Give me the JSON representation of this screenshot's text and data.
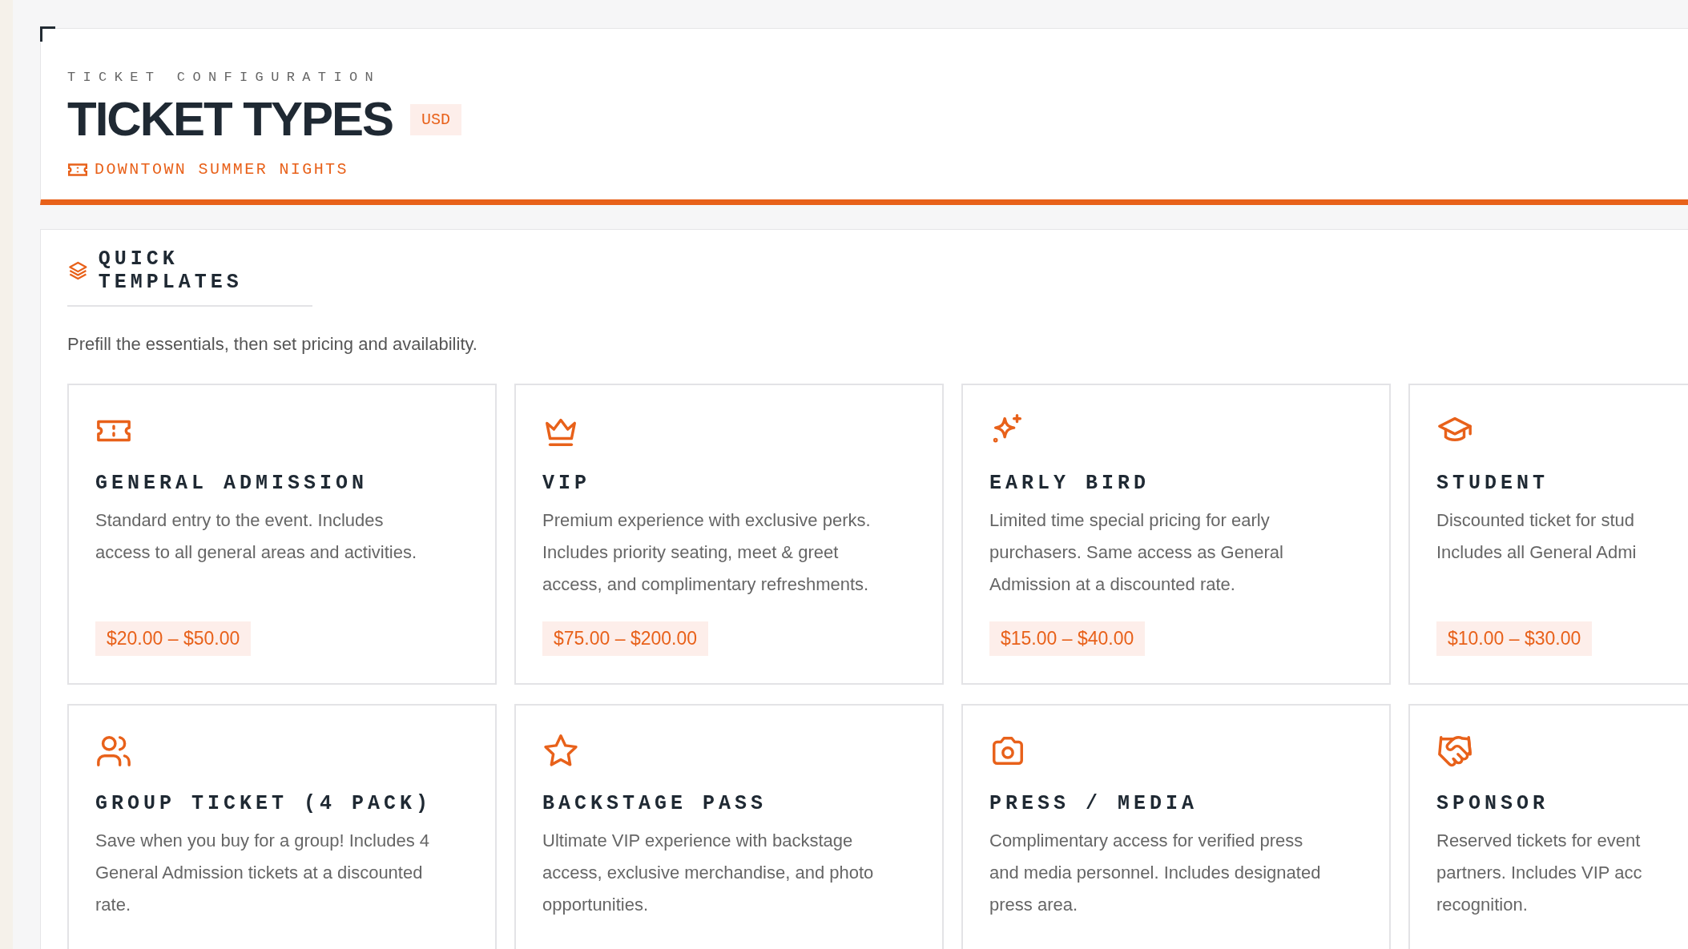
{
  "header": {
    "eyebrow": "TICKET CONFIGURATION",
    "title": "TICKET TYPES",
    "currency": "USD",
    "event": "DOWNTOWN SUMMER NIGHTS"
  },
  "templates": {
    "title": "QUICK TEMPLATES",
    "description": "Prefill the essentials, then set pricing and availability.",
    "cards": [
      {
        "name": "GENERAL ADMISSION",
        "description": "Standard entry to the event. Includes\naccess to all general areas and activities.",
        "price": "$20.00 – $50.00"
      },
      {
        "name": "VIP",
        "description": "Premium experience with exclusive perks.\nIncludes priority seating, meet & greet\naccess, and complimentary refreshments.",
        "price": "$75.00 – $200.00"
      },
      {
        "name": "EARLY BIRD",
        "description": "Limited time special pricing for early\npurchasers. Same access as General\nAdmission at a discounted rate.",
        "price": "$15.00 – $40.00"
      },
      {
        "name": "STUDENT",
        "description": "Discounted ticket for stud\nIncludes all General Admi",
        "price": "$10.00 – $30.00"
      },
      {
        "name": "GROUP TICKET (4 PACK)",
        "description": "Save when you buy for a group! Includes 4\nGeneral Admission tickets at a discounted\nrate."
      },
      {
        "name": "BACKSTAGE PASS",
        "description": "Ultimate VIP experience with backstage\naccess, exclusive merchandise, and photo\nopportunities."
      },
      {
        "name": "PRESS / MEDIA",
        "description": "Complimentary access for verified press\nand media personnel. Includes designated\npress area."
      },
      {
        "name": "SPONSOR",
        "description": "Reserved tickets for event\npartners. Includes VIP acc\nrecognition."
      }
    ]
  }
}
